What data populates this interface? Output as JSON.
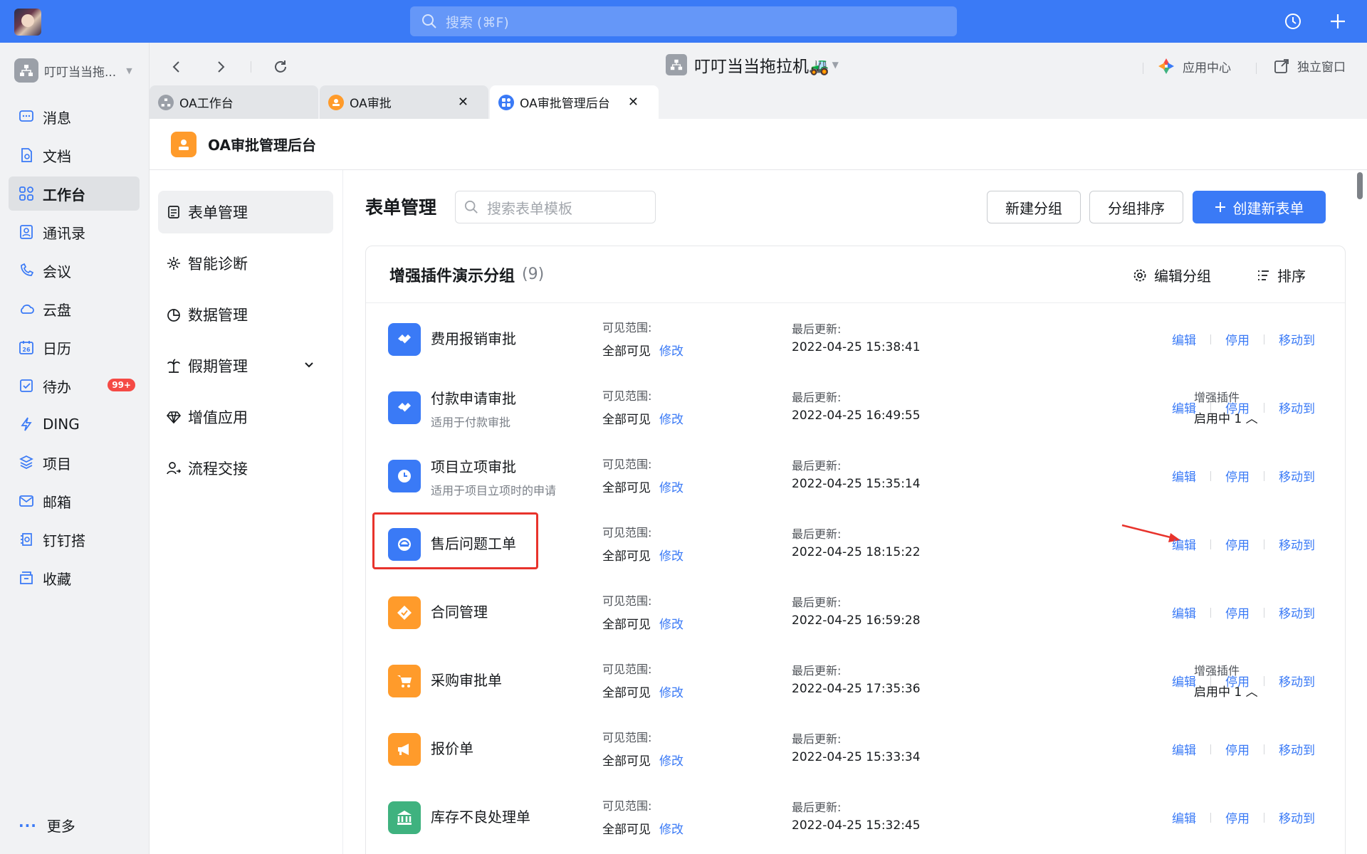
{
  "topbar": {
    "search_placeholder": "搜索 (⌘F)"
  },
  "sidebar": {
    "org_name": "叮叮当当拖...",
    "items": [
      {
        "label": "消息",
        "icon": "message-icon"
      },
      {
        "label": "文档",
        "icon": "document-icon"
      },
      {
        "label": "工作台",
        "icon": "workbench-icon",
        "active": true
      },
      {
        "label": "通讯录",
        "icon": "contacts-icon"
      },
      {
        "label": "会议",
        "icon": "meeting-icon"
      },
      {
        "label": "云盘",
        "icon": "cloud-icon"
      },
      {
        "label": "日历",
        "icon": "calendar-icon",
        "day": "26"
      },
      {
        "label": "待办",
        "icon": "todo-icon",
        "badge": "99+"
      },
      {
        "label": "DING",
        "icon": "ding-icon"
      },
      {
        "label": "项目",
        "icon": "project-icon"
      },
      {
        "label": "邮箱",
        "icon": "mail-icon"
      },
      {
        "label": "钉钉搭",
        "icon": "dingda-icon"
      },
      {
        "label": "收藏",
        "icon": "favorite-icon"
      }
    ],
    "more": "更多"
  },
  "chrome": {
    "title": "叮叮当当拖拉机🚜",
    "app_center": "应用中心",
    "standalone": "独立窗口",
    "tabs": [
      {
        "label": "OA工作台"
      },
      {
        "label": "OA审批"
      },
      {
        "label": "OA审批管理后台"
      }
    ]
  },
  "app": {
    "name": "OA审批管理后台"
  },
  "subnav": {
    "items": [
      {
        "label": "表单管理"
      },
      {
        "label": "智能诊断"
      },
      {
        "label": "数据管理"
      },
      {
        "label": "假期管理"
      },
      {
        "label": "增值应用"
      },
      {
        "label": "流程交接"
      }
    ]
  },
  "main": {
    "title": "表单管理",
    "search_placeholder": "搜索表单模板",
    "btn_new_group": "新建分组",
    "btn_sort_group": "分组排序",
    "btn_create": "创建新表单",
    "group": {
      "name": "增强插件演示分组",
      "count": "(9)",
      "edit_group": "编辑分组",
      "sort": "排序"
    },
    "labels": {
      "scope": "可见范围:",
      "scope_value": "全部可见",
      "modify": "修改",
      "updated": "最后更新:",
      "plugin": "增强插件",
      "plugin_value": "启用中 1",
      "edit": "编辑",
      "disable": "停用",
      "move": "移动到"
    },
    "forms": [
      {
        "name": "费用报销审批",
        "desc": "",
        "updated": "2022-04-25 15:38:41",
        "plugin": false,
        "color": "#3a7af6",
        "icon": "handshake-icon"
      },
      {
        "name": "付款申请审批",
        "desc": "适用于付款审批",
        "updated": "2022-04-25 16:49:55",
        "plugin": true,
        "color": "#3a7af6",
        "icon": "handshake-icon"
      },
      {
        "name": "项目立项审批",
        "desc": "适用于项目立项时的申请",
        "updated": "2022-04-25 15:35:14",
        "plugin": false,
        "color": "#3a7af6",
        "icon": "clock-icon"
      },
      {
        "name": "售后问题工单",
        "desc": "",
        "updated": "2022-04-25 18:15:22",
        "plugin": false,
        "color": "#3a7af6",
        "icon": "headset-icon",
        "highlight": true
      },
      {
        "name": "合同管理",
        "desc": "",
        "updated": "2022-04-25 16:59:28",
        "plugin": false,
        "color": "#ff9b2b",
        "icon": "contract-icon"
      },
      {
        "name": "采购审批单",
        "desc": "",
        "updated": "2022-04-25 17:35:36",
        "plugin": true,
        "color": "#ff9b2b",
        "icon": "cart-icon"
      },
      {
        "name": "报价单",
        "desc": "",
        "updated": "2022-04-25 15:33:34",
        "plugin": false,
        "color": "#ff9b2b",
        "icon": "megaphone-icon"
      },
      {
        "name": "库存不良处理单",
        "desc": "",
        "updated": "2022-04-25 15:32:45",
        "plugin": false,
        "color": "#3fb27f",
        "icon": "bank-icon"
      }
    ]
  }
}
